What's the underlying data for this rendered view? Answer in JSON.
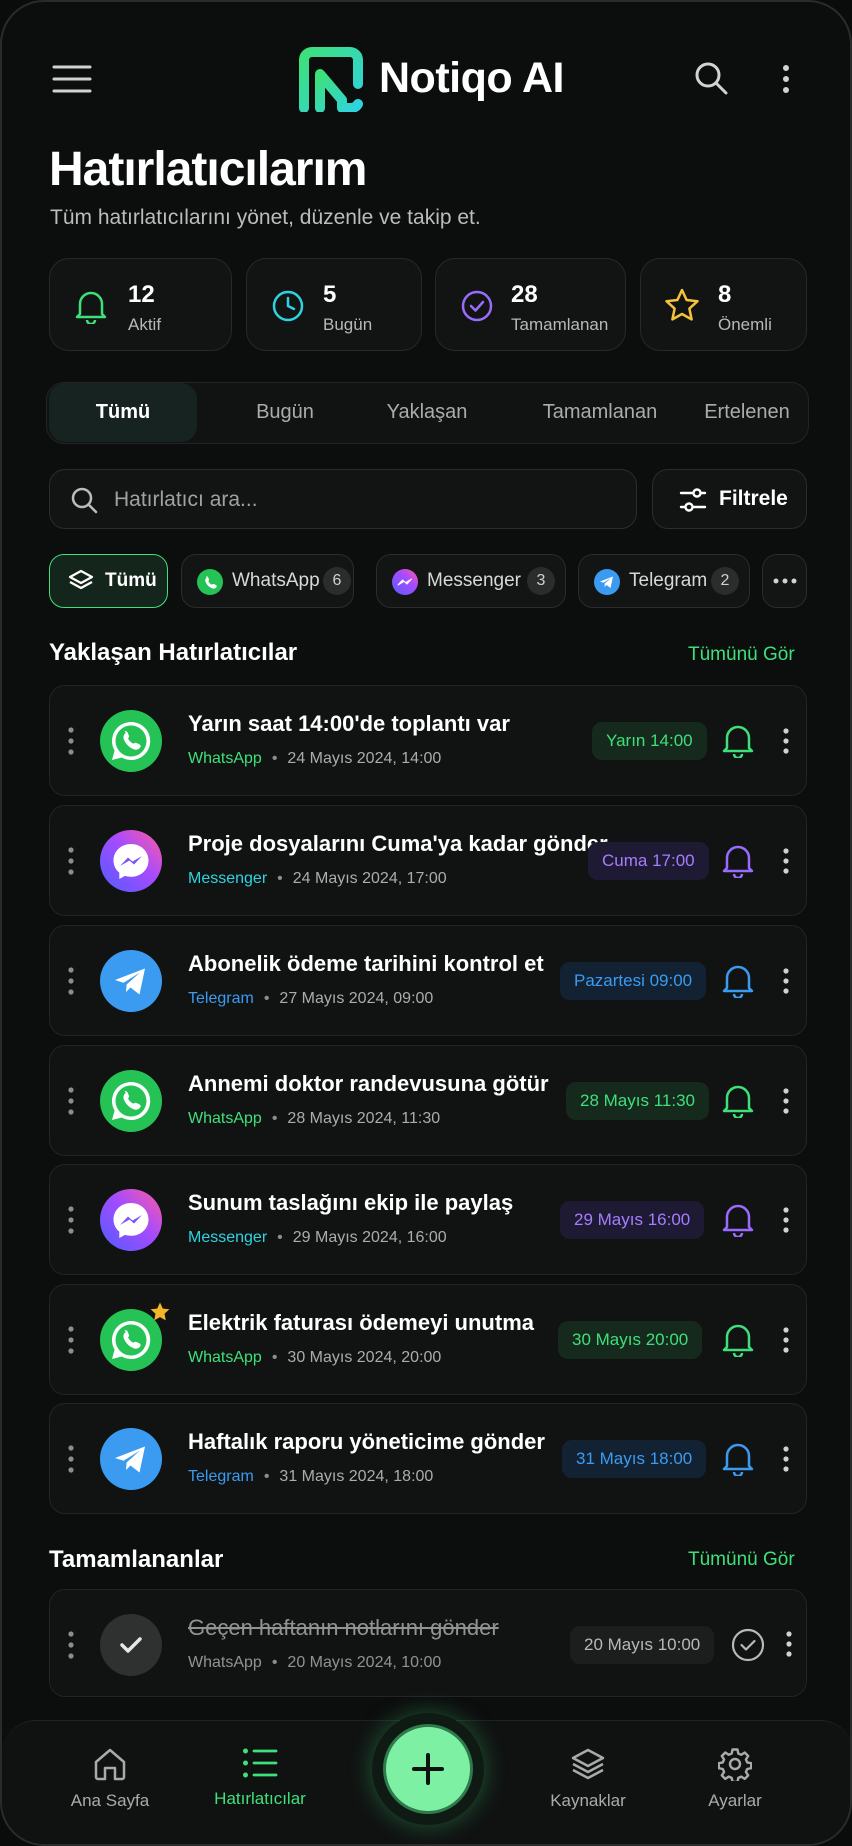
{
  "app": {
    "name": "Notiqo AI"
  },
  "page": {
    "title": "Hatırlatıcılarım",
    "subtitle": "Tüm hatırlatıcılarını yönet, düzenle ve takip et."
  },
  "stats": [
    {
      "value": "12",
      "label": "Aktif",
      "icon": "bell-icon",
      "color": "#3ee07a"
    },
    {
      "value": "5",
      "label": "Bugün",
      "icon": "clock-icon",
      "color": "#2fd3e0"
    },
    {
      "value": "28",
      "label": "Tamamlanan",
      "icon": "check-circle-icon",
      "color": "#9a6bff"
    },
    {
      "value": "8",
      "label": "Önemli",
      "icon": "star-icon",
      "color": "#f5c33b"
    }
  ],
  "tabs": [
    "Tümü",
    "Bugün",
    "Yaklaşan",
    "Tamamlanan",
    "Ertelenen"
  ],
  "active_tab": "Tümü",
  "search": {
    "placeholder": "Hatırlatıcı ara..."
  },
  "filter": {
    "label": "Filtrele"
  },
  "source_chips": [
    {
      "label": "Tümü",
      "count": null,
      "icon": "layers-icon"
    },
    {
      "label": "WhatsApp",
      "count": "6",
      "icon": "whatsapp-icon"
    },
    {
      "label": "Messenger",
      "count": "3",
      "icon": "messenger-icon"
    },
    {
      "label": "Telegram",
      "count": "2",
      "icon": "telegram-icon"
    }
  ],
  "upcoming": {
    "title": "Yaklaşan Hatırlatıcılar",
    "see_all": "Tümünü Gör",
    "items": [
      {
        "title": "Yarın saat 14:00'de toplantı var",
        "source": "WhatsApp",
        "date": "24 Mayıs 2024, 14:00",
        "badge": "Yarın 14:00",
        "starred": false
      },
      {
        "title": "Proje dosyalarını Cuma'ya kadar gönder",
        "source": "Messenger",
        "date": "24 Mayıs 2024, 17:00",
        "badge": "Cuma 17:00",
        "starred": false
      },
      {
        "title": "Abonelik ödeme tarihini kontrol et",
        "source": "Telegram",
        "date": "27 Mayıs 2024, 09:00",
        "badge": "Pazartesi 09:00",
        "starred": false
      },
      {
        "title": "Annemi doktor randevusuna götür",
        "source": "WhatsApp",
        "date": "28 Mayıs 2024, 11:30",
        "badge": "28 Mayıs 11:30",
        "starred": false
      },
      {
        "title": "Sunum taslağını ekip ile paylaş",
        "source": "Messenger",
        "date": "29 Mayıs 2024, 16:00",
        "badge": "29 Mayıs 16:00",
        "starred": false
      },
      {
        "title": "Elektrik faturası ödemeyi unutma",
        "source": "WhatsApp",
        "date": "30 Mayıs 2024, 20:00",
        "badge": "30 Mayıs 20:00",
        "starred": true
      },
      {
        "title": "Haftalık raporu yöneticime gönder",
        "source": "Telegram",
        "date": "31 Mayıs 2024, 18:00",
        "badge": "31 Mayıs 18:00",
        "starred": false
      }
    ]
  },
  "completed": {
    "title": "Tamamlananlar",
    "see_all": "Tümünü Gör",
    "items": [
      {
        "title": "Geçen haftanın notlarını gönder",
        "source": "WhatsApp",
        "date": "20 Mayıs 2024, 10:00",
        "badge": "20 Mayıs 10:00"
      }
    ]
  },
  "colors": {
    "whatsapp": "#3ee07a",
    "messenger": "#9a6bff",
    "telegram": "#3a9bf0",
    "accent": "#3ee07a"
  },
  "nav": [
    {
      "label": "Ana Sayfa",
      "icon": "home-icon"
    },
    {
      "label": "Hatırlatıcılar",
      "icon": "list-icon",
      "active": true
    },
    {
      "label": "",
      "icon": "plus-icon"
    },
    {
      "label": "Kaynaklar",
      "icon": "layers-icon"
    },
    {
      "label": "Ayarlar",
      "icon": "gear-icon"
    }
  ]
}
